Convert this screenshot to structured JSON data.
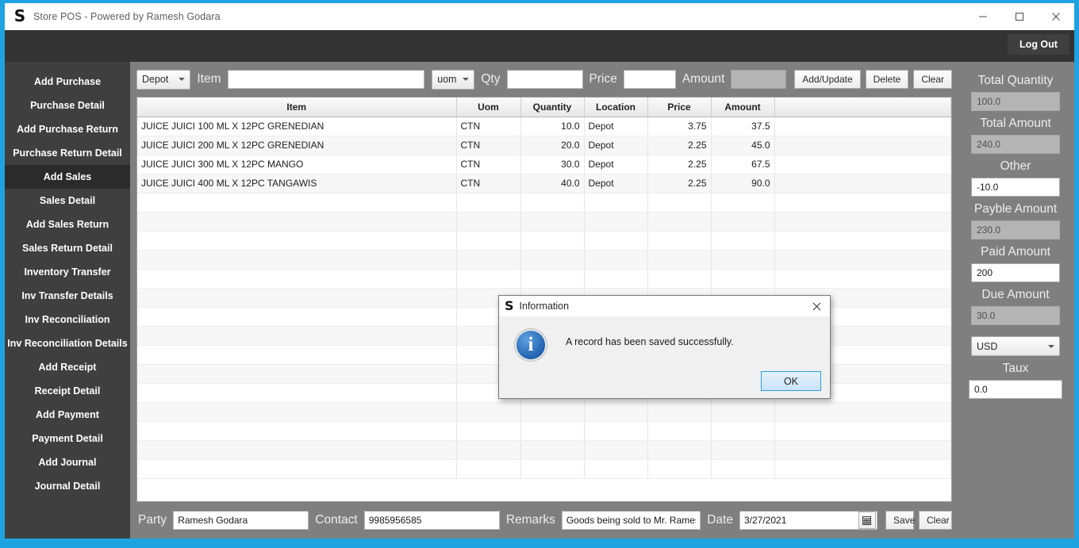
{
  "window": {
    "title": "Store POS - Powered by Ramesh Godara",
    "logo_glyph": "S",
    "minimize": "—",
    "maximize": "☐",
    "close": "✕"
  },
  "header": {
    "logout_label": "Log Out"
  },
  "sidebar": {
    "items": [
      {
        "label": "Add Purchase",
        "active": false
      },
      {
        "label": "Purchase Detail",
        "active": false
      },
      {
        "label": "Add Purchase Return",
        "active": false
      },
      {
        "label": "Purchase Return Detail",
        "active": false
      },
      {
        "label": "Add Sales",
        "active": true
      },
      {
        "label": "Sales Detail",
        "active": false
      },
      {
        "label": "Add Sales Return",
        "active": false
      },
      {
        "label": "Sales Return Detail",
        "active": false
      },
      {
        "label": "Inventory Transfer",
        "active": false
      },
      {
        "label": "Inv Transfer Details",
        "active": false
      },
      {
        "label": "Inv Reconciliation",
        "active": false
      },
      {
        "label": "Inv Reconciliation Details",
        "active": false
      },
      {
        "label": "Add Receipt",
        "active": false
      },
      {
        "label": "Receipt Detail",
        "active": false
      },
      {
        "label": "Add Payment",
        "active": false
      },
      {
        "label": "Payment Detail",
        "active": false
      },
      {
        "label": "Add Journal",
        "active": false
      },
      {
        "label": "Journal Detail",
        "active": false
      }
    ]
  },
  "entry_bar": {
    "location_value": "Depot",
    "item_label": "Item",
    "item_value": "",
    "uom_value": "uom",
    "qty_label": "Qty",
    "qty_value": "",
    "price_label": "Price",
    "price_value": "",
    "amount_label": "Amount",
    "amount_value": "",
    "add_update_label": "Add/Update",
    "delete_label": "Delete",
    "clear_label": "Clear"
  },
  "grid": {
    "columns": [
      "Item",
      "Uom",
      "Quantity",
      "Location",
      "Price",
      "Amount",
      ""
    ],
    "rows": [
      {
        "item": "JUICE JUICI 100 ML X 12PC GRENEDIAN",
        "uom": "CTN",
        "quantity": "10.0",
        "location": "Depot",
        "price": "3.75",
        "amount": "37.5"
      },
      {
        "item": "JUICE JUICI 200 ML X 12PC GRENEDIAN",
        "uom": "CTN",
        "quantity": "20.0",
        "location": "Depot",
        "price": "2.25",
        "amount": "45.0"
      },
      {
        "item": "JUICE JUICI 300 ML X 12PC MANGO",
        "uom": "CTN",
        "quantity": "30.0",
        "location": "Depot",
        "price": "2.25",
        "amount": "67.5"
      },
      {
        "item": "JUICE JUICI 400 ML X 12PC TANGAWIS",
        "uom": "CTN",
        "quantity": "40.0",
        "location": "Depot",
        "price": "2.25",
        "amount": "90.0"
      }
    ],
    "empty_row_count": 15
  },
  "totals": {
    "total_quantity_label": "Total Quantity",
    "total_quantity_value": "100.0",
    "total_amount_label": "Total Amount",
    "total_amount_value": "240.0",
    "other_label": "Other",
    "other_value": "-10.0",
    "payble_amount_label": "Payble Amount",
    "payble_amount_value": "230.0",
    "paid_amount_label": "Paid Amount",
    "paid_amount_value": "200",
    "due_amount_label": "Due Amount",
    "due_amount_value": "30.0",
    "currency_value": "USD",
    "taux_label": "Taux",
    "taux_value": "0.0"
  },
  "footer": {
    "party_label": "Party",
    "party_value": "Ramesh Godara",
    "contact_label": "Contact",
    "contact_value": "9985956585",
    "remarks_label": "Remarks",
    "remarks_value": "Goods being sold to Mr. Ramesh Go",
    "date_label": "Date",
    "date_value": "3/27/2021",
    "calendar_glyph": "▦",
    "save_label": "Save",
    "clear_label": "Clear"
  },
  "dialog": {
    "logo_glyph": "S",
    "title": "Information",
    "close_glyph": "✕",
    "icon_glyph": "i",
    "message": "A record has been saved successfully.",
    "ok_label": "OK"
  },
  "colors": {
    "window_border": "#1fa3e0",
    "header_dark": "#333333",
    "sidebar": "#3f3f3f",
    "sidebar_active": "#2b2b2b",
    "content_gray": "#7f7f7f",
    "accent_blue": "#2aa0df"
  }
}
